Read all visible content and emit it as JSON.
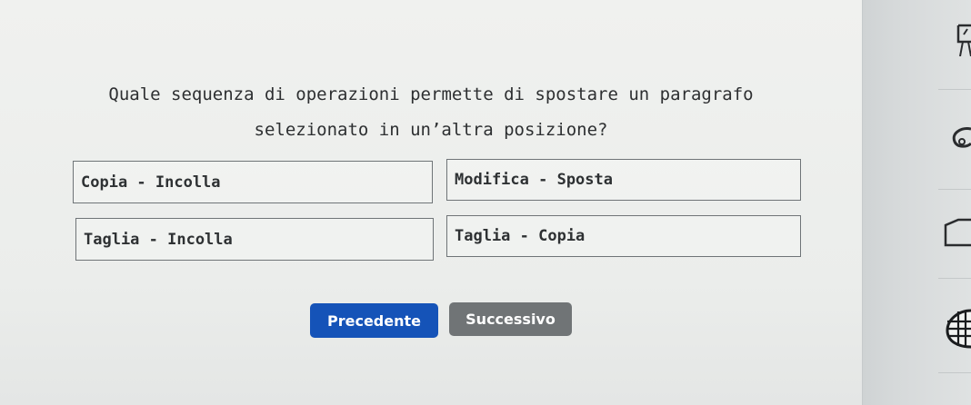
{
  "question": {
    "line1": "Quale sequenza di operazioni permette di spostare un paragrafo",
    "line2": "selezionato in un’altra posizione?"
  },
  "answers": [
    {
      "label": "Copia - Incolla"
    },
    {
      "label": "Modifica - Sposta"
    },
    {
      "label": "Taglia - Incolla"
    },
    {
      "label": "Taglia - Copia"
    }
  ],
  "navigation": {
    "prev_label": "Precedente",
    "next_label": "Successivo"
  },
  "colors": {
    "prev_button": "#1553b8",
    "next_button": "#707476",
    "panel_background": "#eeefed",
    "text": "#2d2f31"
  },
  "side_icons": [
    "presentation-icon",
    "shape-icon",
    "rectangle-icon",
    "table-icon"
  ]
}
